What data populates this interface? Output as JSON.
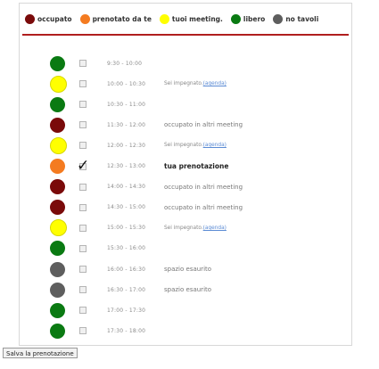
{
  "colors": {
    "occupato": "#7a0a0a",
    "prenotato": "#f47b20",
    "tuoi": "#ffff00",
    "libero": "#0a7a12",
    "no_tavoli": "#5e5e5e",
    "header_line": "#b01e1e"
  },
  "legend": [
    {
      "label": "occupato",
      "color": "#7a0a0a"
    },
    {
      "label": "prenotato da te",
      "color": "#f47b20"
    },
    {
      "label": "tuoi meeting.",
      "color": "#ffff00"
    },
    {
      "label": "libero",
      "color": "#0a7a12"
    },
    {
      "label": "no tavoli",
      "color": "#5e5e5e"
    }
  ],
  "slots": [
    {
      "time": "9:30 - 10:00",
      "state": "libero",
      "status": ""
    },
    {
      "time": "10:00 - 10:30",
      "state": "tuoi",
      "status": "Sei impegnato.",
      "link": "(agenda)"
    },
    {
      "time": "10:30 - 11:00",
      "state": "libero",
      "status": ""
    },
    {
      "time": "11:30 - 12:00",
      "state": "occupato",
      "status": "occupato in altri meeting"
    },
    {
      "time": "12:00 - 12:30",
      "state": "tuoi",
      "status": "Sei impegnato.",
      "link": "(agenda)"
    },
    {
      "time": "12:30 - 13:00",
      "state": "prenotato",
      "status": "tua prenotazione",
      "checked": true
    },
    {
      "time": "14:00 - 14:30",
      "state": "occupato",
      "status": "occupato in altri meeting"
    },
    {
      "time": "14:30 - 15:00",
      "state": "occupato",
      "status": "occupato in altri meeting"
    },
    {
      "time": "15:00 - 15:30",
      "state": "tuoi",
      "status": "Sei impegnato.",
      "link": "(agenda)"
    },
    {
      "time": "15:30 - 16:00",
      "state": "libero",
      "status": ""
    },
    {
      "time": "16:00 - 16:30",
      "state": "no_tavoli",
      "status": "spazio esaurito"
    },
    {
      "time": "16:30 - 17:00",
      "state": "no_tavoli",
      "status": "spazio esaurito"
    },
    {
      "time": "17:00 - 17:30",
      "state": "libero",
      "status": ""
    },
    {
      "time": "17:30 - 18:00",
      "state": "libero",
      "status": ""
    }
  ],
  "save_button": "Salva la prenotazione"
}
